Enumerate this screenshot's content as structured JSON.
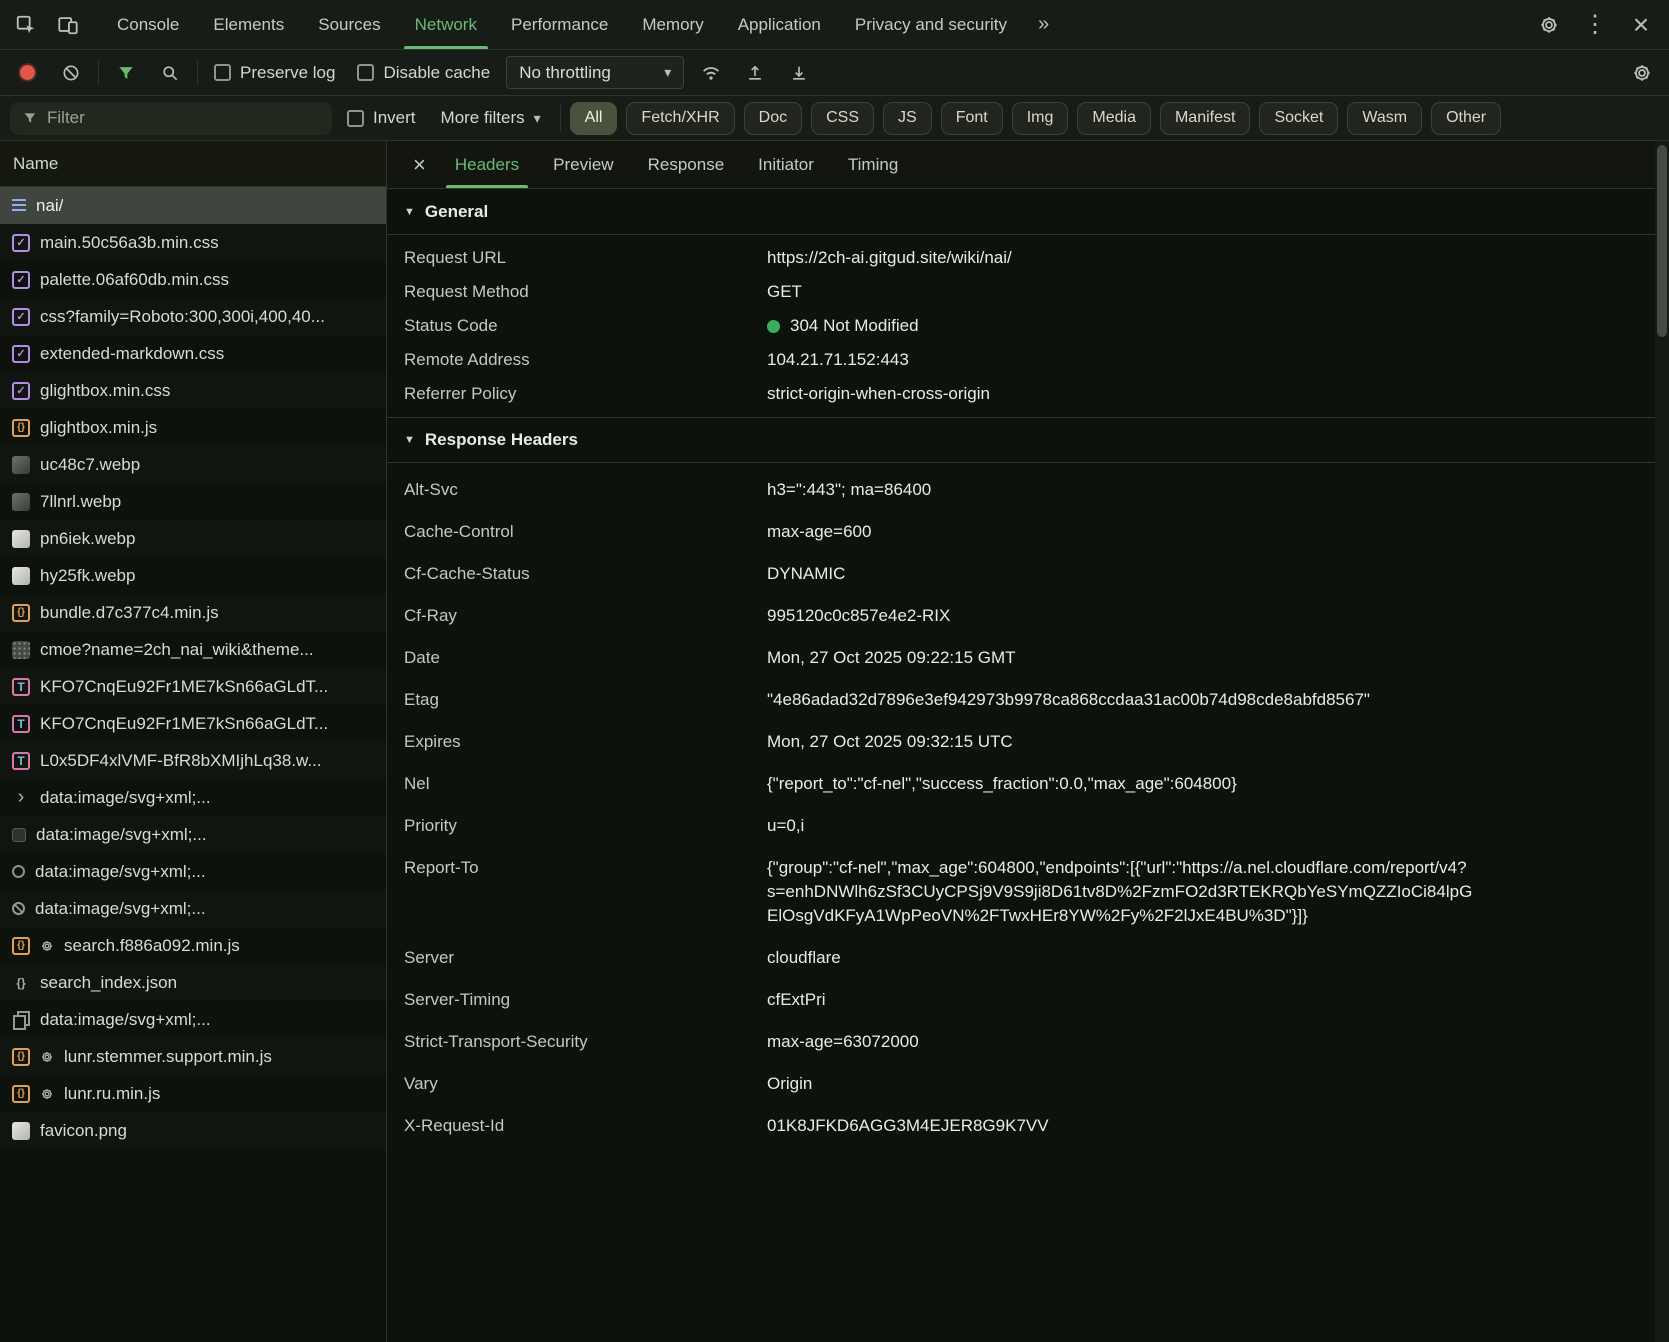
{
  "icons": {
    "more_tabs": "»",
    "kebab": "⋮",
    "close": "×",
    "caret_down": "▾",
    "disclosure": "▼"
  },
  "window": {
    "top_tabs": [
      {
        "label": "Console"
      },
      {
        "label": "Elements"
      },
      {
        "label": "Sources"
      },
      {
        "label": "Network",
        "active": true
      },
      {
        "label": "Performance"
      },
      {
        "label": "Memory"
      },
      {
        "label": "Application"
      },
      {
        "label": "Privacy and security"
      }
    ]
  },
  "network_toolbar": {
    "preserve_log_label": "Preserve log",
    "disable_cache_label": "Disable cache",
    "throttling_value": "No throttling"
  },
  "filter_bar": {
    "filter_placeholder": "Filter",
    "invert_label": "Invert",
    "more_filters_label": "More filters",
    "chips": [
      {
        "label": "All",
        "active": true
      },
      {
        "label": "Fetch/XHR"
      },
      {
        "label": "Doc"
      },
      {
        "label": "CSS"
      },
      {
        "label": "JS"
      },
      {
        "label": "Font"
      },
      {
        "label": "Img"
      },
      {
        "label": "Media"
      },
      {
        "label": "Manifest"
      },
      {
        "label": "Socket"
      },
      {
        "label": "Wasm"
      },
      {
        "label": "Other"
      }
    ]
  },
  "request_list": {
    "name_header": "Name",
    "rows": [
      {
        "name": "nai/",
        "icon": "doc",
        "selected": true
      },
      {
        "name": "main.50c56a3b.min.css",
        "icon": "css"
      },
      {
        "name": "palette.06af60db.min.css",
        "icon": "css"
      },
      {
        "name": "css?family=Roboto:300,300i,400,40...",
        "icon": "css"
      },
      {
        "name": "extended-markdown.css",
        "icon": "css"
      },
      {
        "name": "glightbox.min.css",
        "icon": "css"
      },
      {
        "name": "glightbox.min.js",
        "icon": "js"
      },
      {
        "name": "uc48c7.webp",
        "icon": "img-dark"
      },
      {
        "name": "7llnrl.webp",
        "icon": "img-dark"
      },
      {
        "name": "pn6iek.webp",
        "icon": "img-light"
      },
      {
        "name": "hy25fk.webp",
        "icon": "img-light"
      },
      {
        "name": "bundle.d7c377c4.min.js",
        "icon": "js"
      },
      {
        "name": "cmoe?name=2ch_nai_wiki&theme...",
        "icon": "sprite"
      },
      {
        "name": "KFO7CnqEu92Fr1ME7kSn66aGLdT...",
        "icon": "font"
      },
      {
        "name": "KFO7CnqEu92Fr1ME7kSn66aGLdT...",
        "icon": "font"
      },
      {
        "name": "L0x5DF4xlVMF-BfR8bXMIjhLq38.w...",
        "icon": "font"
      },
      {
        "name": "data:image/svg+xml;...",
        "icon": "svg-chevron"
      },
      {
        "name": "data:image/svg+xml;...",
        "icon": "svg-dark"
      },
      {
        "name": "data:image/svg+xml;...",
        "icon": "svg-circle"
      },
      {
        "name": "data:image/svg+xml;...",
        "icon": "svg-slash"
      },
      {
        "name": "search.f886a092.min.js",
        "icon": "js",
        "gear": true
      },
      {
        "name": "search_index.json",
        "icon": "json"
      },
      {
        "name": "data:image/svg+xml;...",
        "icon": "svg-copy"
      },
      {
        "name": "lunr.stemmer.support.min.js",
        "icon": "js",
        "gear": true
      },
      {
        "name": "lunr.ru.min.js",
        "icon": "js",
        "gear": true
      },
      {
        "name": "favicon.png",
        "icon": "img-light"
      }
    ]
  },
  "details": {
    "tabs": [
      {
        "label": "Headers",
        "active": true
      },
      {
        "label": "Preview"
      },
      {
        "label": "Response"
      },
      {
        "label": "Initiator"
      },
      {
        "label": "Timing"
      }
    ],
    "general": {
      "title": "General",
      "items": [
        {
          "key": "Request URL",
          "value": "https://2ch-ai.gitgud.site/wiki/nai/"
        },
        {
          "key": "Request Method",
          "value": "GET"
        },
        {
          "key": "Status Code",
          "value": "304 Not Modified",
          "dot": true
        },
        {
          "key": "Remote Address",
          "value": "104.21.71.152:443"
        },
        {
          "key": "Referrer Policy",
          "value": "strict-origin-when-cross-origin"
        }
      ]
    },
    "response_headers": {
      "title": "Response Headers",
      "items": [
        {
          "key": "Alt-Svc",
          "value": "h3=\":443\"; ma=86400"
        },
        {
          "key": "Cache-Control",
          "value": "max-age=600"
        },
        {
          "key": "Cf-Cache-Status",
          "value": "DYNAMIC"
        },
        {
          "key": "Cf-Ray",
          "value": "995120c0c857e4e2-RIX"
        },
        {
          "key": "Date",
          "value": "Mon, 27 Oct 2025 09:22:15 GMT"
        },
        {
          "key": "Etag",
          "value": "\"4e86adad32d7896e3ef942973b9978ca868ccdaa31ac00b74d98cde8abfd8567\""
        },
        {
          "key": "Expires",
          "value": "Mon, 27 Oct 2025 09:32:15 UTC"
        },
        {
          "key": "Nel",
          "value": "{\"report_to\":\"cf-nel\",\"success_fraction\":0.0,\"max_age\":604800}"
        },
        {
          "key": "Priority",
          "value": "u=0,i"
        },
        {
          "key": "Report-To",
          "value": "{\"group\":\"cf-nel\",\"max_age\":604800,\"endpoints\":[{\"url\":\"https://a.nel.cloudflare.com/report/v4?s=enhDNWlh6zSf3CUyCPSj9V9S9ji8D61tv8D%2FzmFO2d3RTEKRQbYeSYmQZZIoCi84lpGElOsgVdKFyA1WpPeoVN%2FTwxHEr8YW%2Fy%2F2lJxE4BU%3D\"}]}"
        },
        {
          "key": "Server",
          "value": "cloudflare"
        },
        {
          "key": "Server-Timing",
          "value": "cfExtPri"
        },
        {
          "key": "Strict-Transport-Security",
          "value": "max-age=63072000"
        },
        {
          "key": "Vary",
          "value": "Origin"
        },
        {
          "key": "X-Request-Id",
          "value": "01K8JFKD6AGG3M4EJER8G9K7VV"
        }
      ]
    }
  }
}
